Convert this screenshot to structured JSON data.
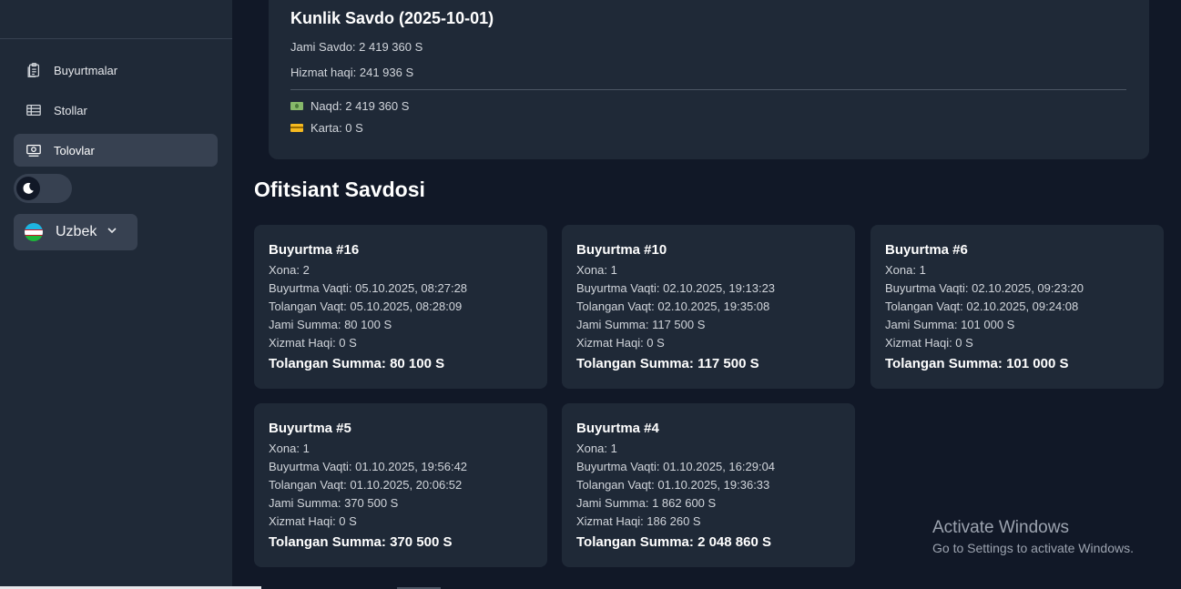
{
  "sidebar": {
    "items": [
      {
        "label": "Buyurtmalar",
        "icon": "clipboard-icon",
        "active": false
      },
      {
        "label": "Stollar",
        "icon": "table-icon",
        "active": false
      },
      {
        "label": "Tolovlar",
        "icon": "cash-icon",
        "active": true
      }
    ],
    "theme_toggle": {
      "icon": "moon-icon",
      "mode": "dark"
    },
    "language": {
      "label": "Uzbek",
      "icon": "uz-flag-icon"
    }
  },
  "summary": {
    "title": "Kunlik Savdo (2025-10-01)",
    "total_sales": "Jami Savdo: 2 419 360 S",
    "service_fee": "Hizmat haqi: 241 936 S",
    "cash": "Naqd: 2 419 360 S",
    "card": "Karta: 0 S"
  },
  "section_title": "Ofitsiant Savdosi",
  "orders": [
    {
      "title": "Buyurtma #16",
      "room": "Xona: 2",
      "order_time": "Buyurtma Vaqti: 05.10.2025, 08:27:28",
      "paid_time": "Tolangan Vaqt: 05.10.2025, 08:28:09",
      "total": "Jami Summa: 80 100 S",
      "service": "Xizmat Haqi: 0 S",
      "paid": "Tolangan Summa: 80 100 S"
    },
    {
      "title": "Buyurtma #10",
      "room": "Xona: 1",
      "order_time": "Buyurtma Vaqti: 02.10.2025, 19:13:23",
      "paid_time": "Tolangan Vaqt: 02.10.2025, 19:35:08",
      "total": "Jami Summa: 117 500 S",
      "service": "Xizmat Haqi: 0 S",
      "paid": "Tolangan Summa: 117 500 S"
    },
    {
      "title": "Buyurtma #6",
      "room": "Xona: 1",
      "order_time": "Buyurtma Vaqti: 02.10.2025, 09:23:20",
      "paid_time": "Tolangan Vaqt: 02.10.2025, 09:24:08",
      "total": "Jami Summa: 101 000 S",
      "service": "Xizmat Haqi: 0 S",
      "paid": "Tolangan Summa: 101 000 S"
    },
    {
      "title": "Buyurtma #5",
      "room": "Xona: 1",
      "order_time": "Buyurtma Vaqti: 01.10.2025, 19:56:42",
      "paid_time": "Tolangan Vaqt: 01.10.2025, 20:06:52",
      "total": "Jami Summa: 370 500 S",
      "service": "Xizmat Haqi: 0 S",
      "paid": "Tolangan Summa: 370 500 S"
    },
    {
      "title": "Buyurtma #4",
      "room": "Xona: 1",
      "order_time": "Buyurtma Vaqti: 01.10.2025, 16:29:04",
      "paid_time": "Tolangan Vaqt: 01.10.2025, 19:36:33",
      "total": "Jami Summa: 1 862 600 S",
      "service": "Xizmat Haqi: 186 260 S",
      "paid": "Tolangan Summa: 2 048 860 S"
    }
  ],
  "watermark": {
    "title": "Activate Windows",
    "subtitle": "Go to Settings to activate Windows."
  }
}
